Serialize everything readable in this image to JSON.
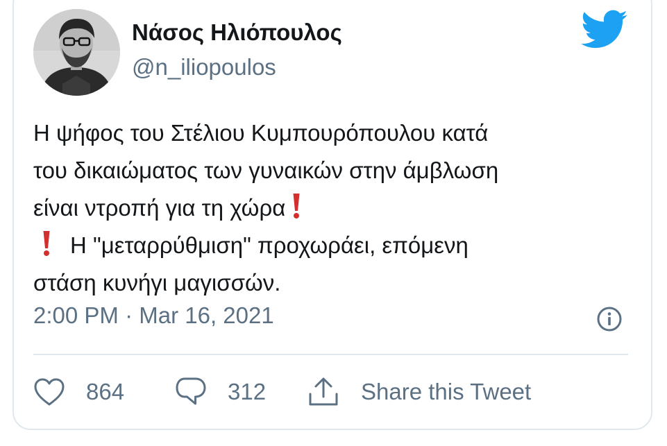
{
  "author": {
    "name": "Νάσος Ηλιόπουλος",
    "handle": "@n_iliopoulos",
    "avatar_icon": "profile-photo"
  },
  "brand": {
    "icon": "twitter-bird-icon",
    "color": "#1da1f2"
  },
  "tweet": {
    "line1": "Η ψήφος του Στέλιου Κυμπουρόπουλου κατά",
    "line2": "του δικαιώματος των γυναικών στην άμβλωση",
    "line3": "είναι ντροπή για τη χώρα",
    "line4": "Η \"μεταρρύθμιση\" προχωράει, επόμενη",
    "line5": "στάση κυνήγι μαγισσών.",
    "emoji_icon": "red-exclamation-mark",
    "emoji_color": "#d32f2f"
  },
  "meta": {
    "time": "2:00 PM",
    "separator": " · ",
    "date": "Mar 16, 2021",
    "info_icon": "info-icon"
  },
  "actions": {
    "likes": "864",
    "replies": "312",
    "share_label": "Share this Tweet"
  },
  "colors": {
    "text": "#14171a",
    "secondary": "#5b7083",
    "border": "#e1e8ed"
  }
}
